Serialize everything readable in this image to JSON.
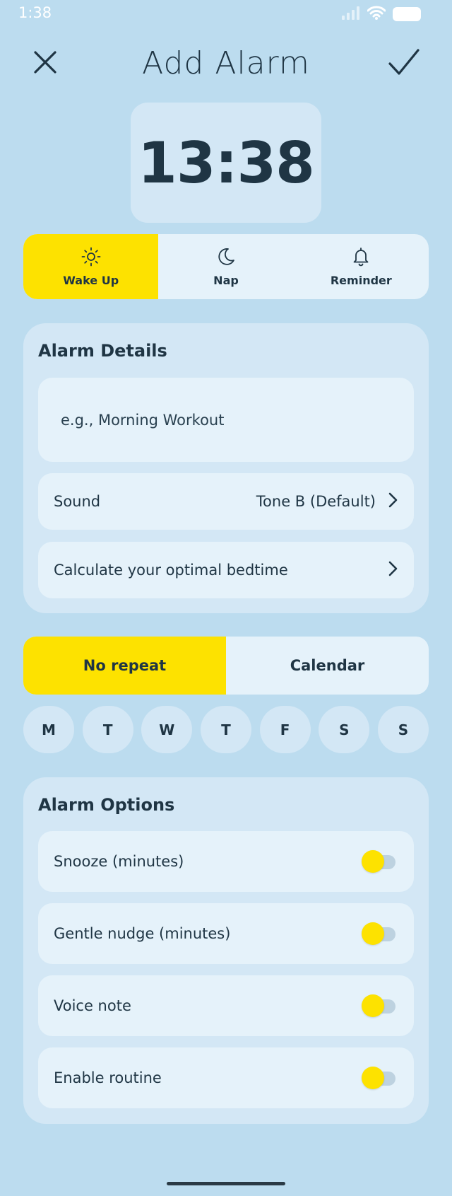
{
  "status_bar": {
    "time": "1:38"
  },
  "header": {
    "title": "Add Alarm"
  },
  "alarm": {
    "time": "13:38"
  },
  "alarm_types": [
    {
      "label": "Wake Up",
      "icon": "sun-icon",
      "active": true
    },
    {
      "label": "Nap",
      "icon": "moon-icon",
      "active": false
    },
    {
      "label": "Reminder",
      "icon": "bell-icon",
      "active": false
    }
  ],
  "details": {
    "title": "Alarm Details",
    "name_placeholder": "e.g., Morning Workout",
    "sound_label": "Sound",
    "sound_value": "Tone B (Default)",
    "bedtime_label": "Calculate your optimal bedtime"
  },
  "repeat": {
    "options": [
      "No repeat",
      "Calendar"
    ],
    "active": "No repeat"
  },
  "days": [
    "M",
    "T",
    "W",
    "T",
    "F",
    "S",
    "S"
  ],
  "options": {
    "title": "Alarm Options",
    "items": [
      {
        "label": "Snooze (minutes)"
      },
      {
        "label": "Gentle nudge (minutes)"
      },
      {
        "label": "Voice note"
      },
      {
        "label": "Enable routine"
      }
    ]
  },
  "colors": {
    "background": "#bcdcef",
    "card": "#d3e7f5",
    "field": "#e5f2fa",
    "accent": "#fde200",
    "text": "#1f3544"
  }
}
